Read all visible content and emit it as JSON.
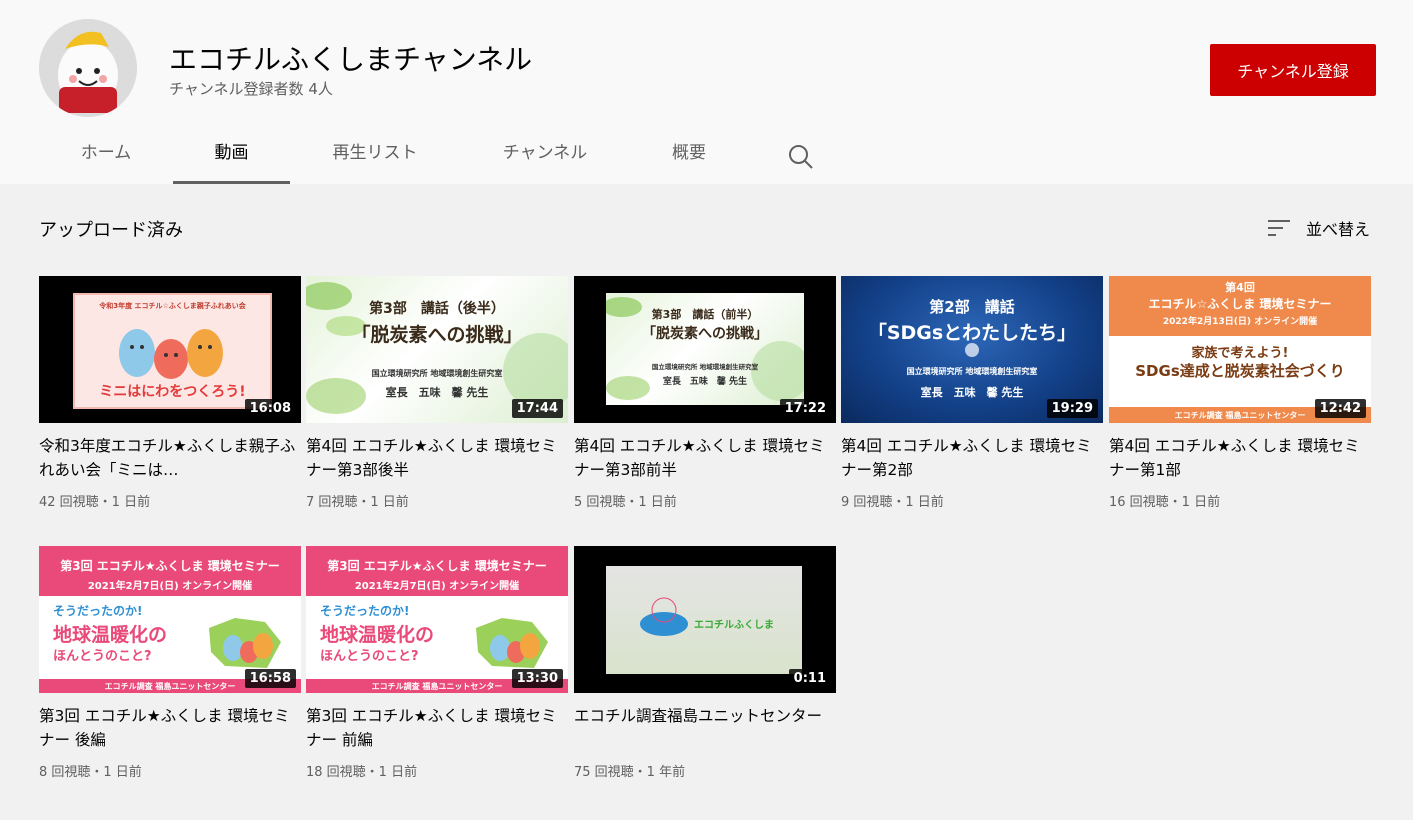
{
  "channel": {
    "name": "エコチルふくしまチャンネル",
    "subscribers": "チャンネル登録者数 4人",
    "subscribe_label": "チャンネル登録"
  },
  "tabs": [
    {
      "label": "ホーム"
    },
    {
      "label": "動画"
    },
    {
      "label": "再生リスト"
    },
    {
      "label": "チャンネル"
    },
    {
      "label": "概要"
    }
  ],
  "section": {
    "title": "アップロード済み",
    "sort_label": "並べ替え"
  },
  "colors": {
    "accent_red": "#cc0000",
    "pink_banner": "#e94a7a",
    "orange_banner": "#ef8a4c",
    "blue_bg": "#123f86"
  },
  "videos": [
    {
      "title": "令和3年度エコチル★ふくしま親子ふれあい会「ミニは…",
      "meta": "42 回視聴・1 日前",
      "duration": "16:08",
      "thumb": {
        "line1": "令和3年度 エコチル☆ふくしま親子ふれあい会",
        "line2": "ミニはにわをつくろう!"
      }
    },
    {
      "title": "第4回 エコチル★ふくしま 環境セミナー第3部後半",
      "meta": "7 回視聴・1 日前",
      "duration": "17:44",
      "thumb": {
        "line1": "第3部　講話（後半）",
        "line2": "「脱炭素への挑戦」",
        "line3": "国立環境研究所 地域環境創生研究室",
        "line4": "室長　五味　馨 先生"
      }
    },
    {
      "title": "第4回 エコチル★ふくしま 環境セミナー第3部前半",
      "meta": "5 回視聴・1 日前",
      "duration": "17:22",
      "thumb": {
        "line1": "第3部　講話（前半）",
        "line2": "「脱炭素への挑戦」",
        "line3": "国立環境研究所 地域環境創生研究室",
        "line4": "室長　五味　馨 先生"
      }
    },
    {
      "title": "第4回 エコチル★ふくしま 環境セミナー第2部",
      "meta": "9 回視聴・1 日前",
      "duration": "19:29",
      "thumb": {
        "line1": "第2部　講話",
        "line2": "「SDGsとわたしたち」",
        "line3": "国立環境研究所 地域環境創生研究室",
        "line4": "室長　五味　馨 先生"
      }
    },
    {
      "title": "第4回 エコチル★ふくしま 環境セミナー第1部",
      "meta": "16 回視聴・1 日前",
      "duration": "12:42",
      "thumb": {
        "line1": "第4回",
        "line2": "エコチル☆ふくしま 環境セミナー",
        "line3": "2022年2月13日(日) オンライン開催",
        "line4": "家族で考えよう!",
        "line5": "SDGs達成と脱炭素社会づくり",
        "line6": "エコチル調査 福島ユニットセンター"
      }
    },
    {
      "title": "第3回 エコチル★ふくしま 環境セミナー 後編",
      "meta": "8 回視聴・1 日前",
      "duration": "16:58",
      "thumb": {
        "line1": "第3回 エコチル★ふくしま 環境セミナー",
        "line2": "2021年2月7日(日) オンライン開催",
        "line3": "そうだったのか!",
        "line4": "地球温暖化の",
        "line5": "ほんとうのこと?",
        "line6": "エコチル調査 福島ユニットセンター"
      }
    },
    {
      "title": "第3回 エコチル★ふくしま 環境セミナー 前編",
      "meta": "18 回視聴・1 日前",
      "duration": "13:30",
      "thumb": {
        "line1": "第3回 エコチル★ふくしま 環境セミナー",
        "line2": "2021年2月7日(日) オンライン開催",
        "line3": "そうだったのか!",
        "line4": "地球温暖化の",
        "line5": "ほんとうのこと?",
        "line6": "エコチル調査 福島ユニットセンター"
      }
    },
    {
      "title": "エコチル調査福島ユニットセンター",
      "meta": "75 回視聴・1 年前",
      "duration": "0:11",
      "thumb": {
        "line1": "エコチルふくしま"
      }
    }
  ]
}
